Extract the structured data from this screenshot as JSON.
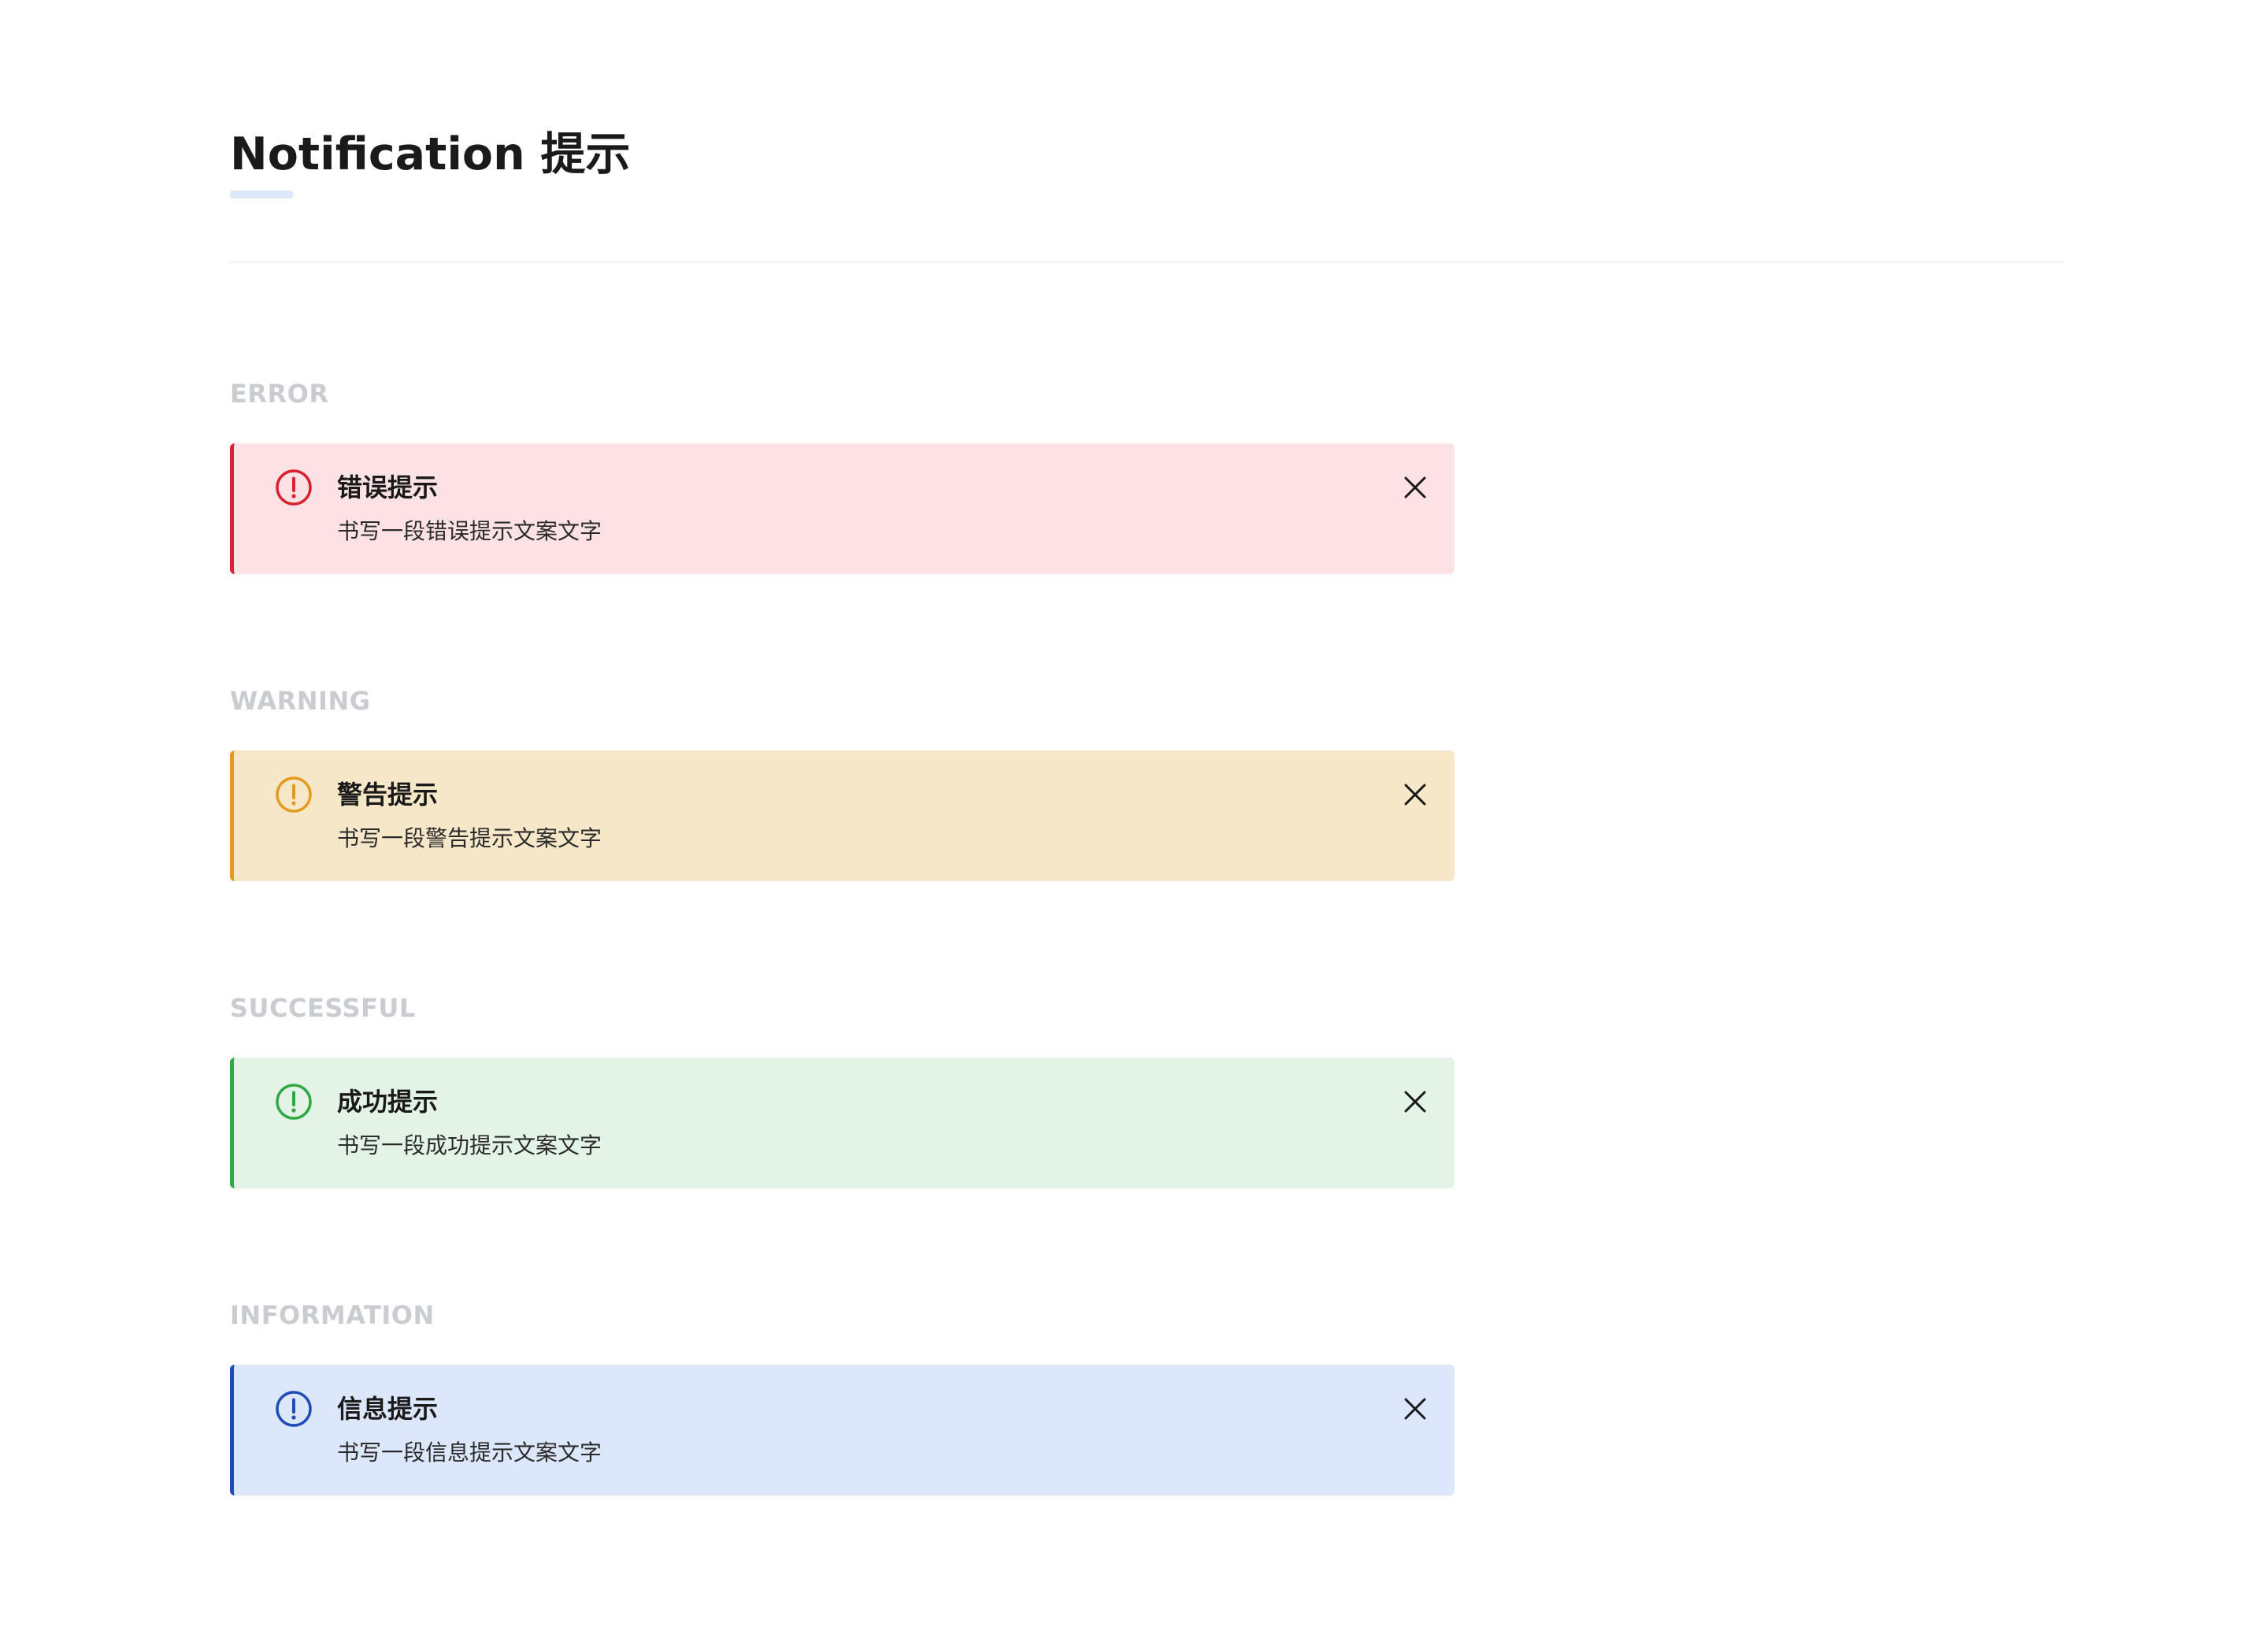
{
  "page": {
    "title": "Notification 提示"
  },
  "sections": [
    {
      "label": "ERROR",
      "alert": {
        "title": "错误提示",
        "body": "书写一段错误提示文案文字",
        "icon": "exclamation-circle-icon",
        "close_icon": "close-icon",
        "accent_color": "#d9212f",
        "background_color": "#fce1e5"
      }
    },
    {
      "label": "WARNING",
      "alert": {
        "title": "警告提示",
        "body": "书写一段警告提示文案文字",
        "icon": "exclamation-circle-icon",
        "close_icon": "close-icon",
        "accent_color": "#e39a1d",
        "background_color": "#f6e7c9"
      }
    },
    {
      "label": "SUCCESSFUL",
      "alert": {
        "title": "成功提示",
        "body": "书写一段成功提示文案文字",
        "icon": "exclamation-circle-icon",
        "close_icon": "close-icon",
        "accent_color": "#2fa846",
        "background_color": "#e3f3e6"
      }
    },
    {
      "label": "INFORMATION",
      "alert": {
        "title": "信息提示",
        "body": "书写一段信息提示文案文字",
        "icon": "exclamation-circle-icon",
        "close_icon": "close-icon",
        "accent_color": "#1e4db7",
        "background_color": "#dde7fb"
      }
    }
  ]
}
